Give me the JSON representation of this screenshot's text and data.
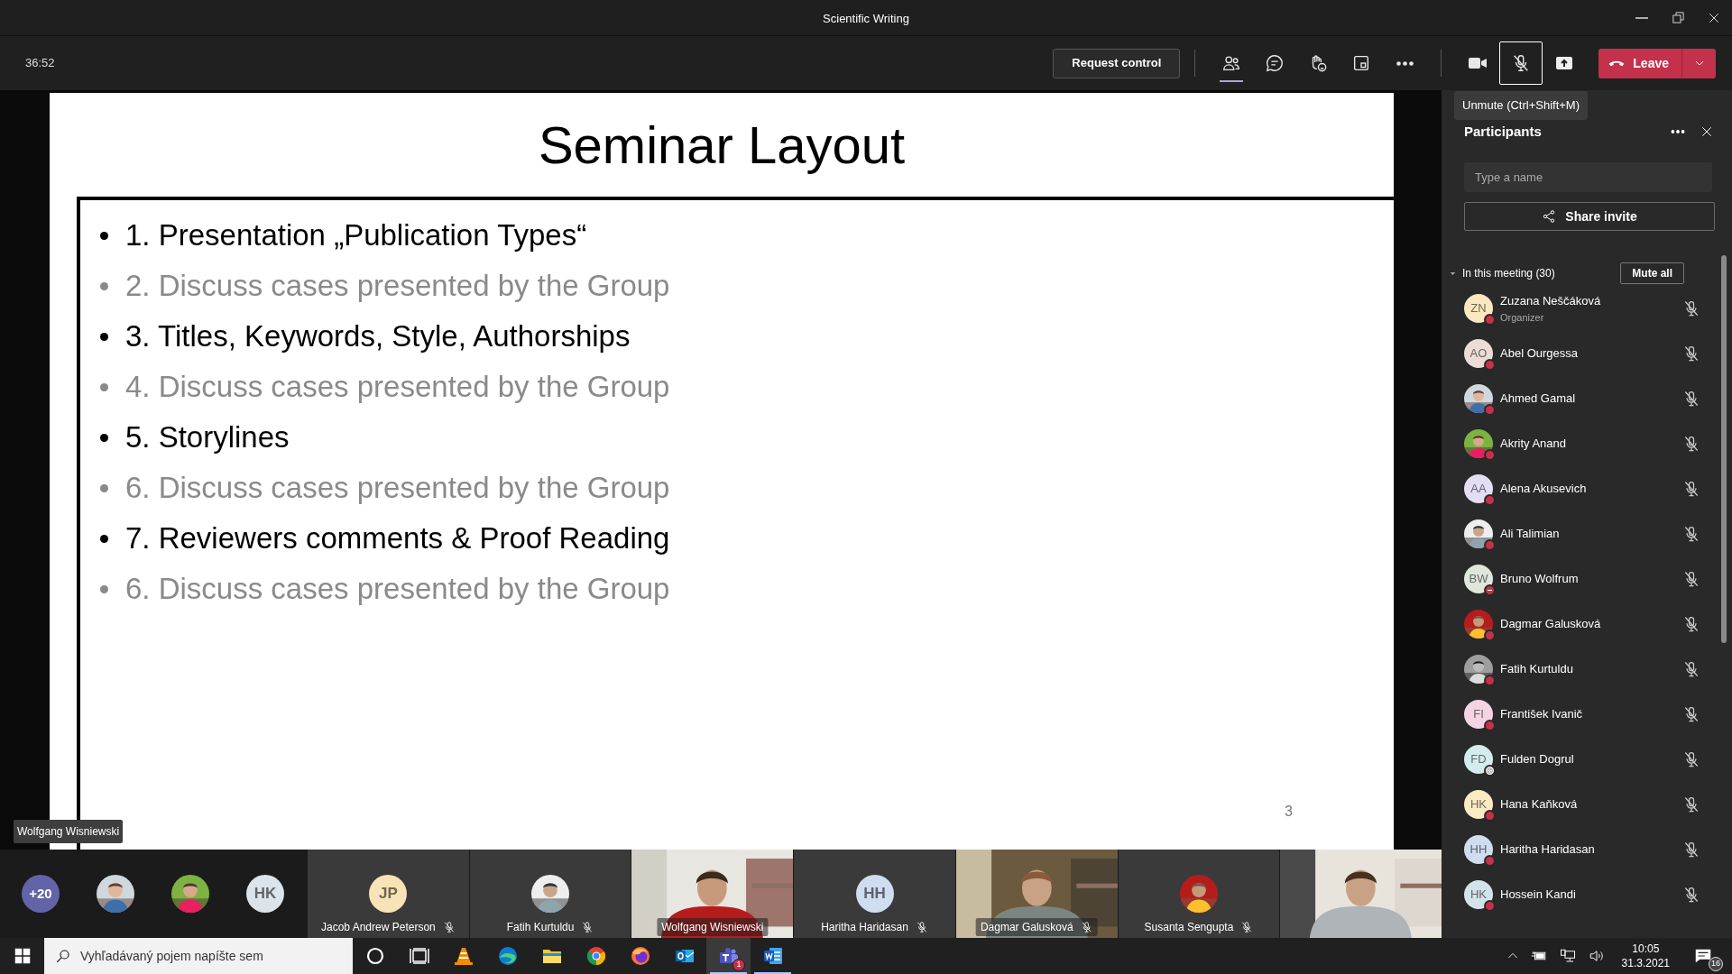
{
  "window": {
    "title": "Scientific Writing"
  },
  "toolbar": {
    "timer": "36:52",
    "request_control": "Request control",
    "buttons": [
      {
        "kind": "people",
        "selected": true
      },
      {
        "kind": "chat",
        "selected": false
      },
      {
        "kind": "reactions",
        "selected": false
      },
      {
        "kind": "rooms",
        "selected": false
      },
      {
        "kind": "more",
        "selected": false
      }
    ],
    "camera": {
      "on": true
    },
    "mic": {
      "on": false,
      "tooltip": "Unmute (Ctrl+Shift+M)"
    },
    "leave": "Leave"
  },
  "slide": {
    "title": "Seminar Layout",
    "bullets": [
      {
        "text": "1. Presentation „Publication Types“",
        "dimmed": false
      },
      {
        "text": "2. Discuss cases presented by the Group",
        "dimmed": true
      },
      {
        "text": "3. Titles, Keywords, Style, Authorships",
        "dimmed": false
      },
      {
        "text": "4. Discuss cases presented by the Group",
        "dimmed": true
      },
      {
        "text": "5. Storylines",
        "dimmed": false
      },
      {
        "text": "6. Discuss cases presented by the Group",
        "dimmed": true
      },
      {
        "text": "7. Reviewers comments & Proof Reading",
        "dimmed": false
      },
      {
        "text": "6. Discuss cases presented by the Group",
        "dimmed": true
      }
    ],
    "page": "3"
  },
  "presenter": "Wolfgang Wisniewski",
  "participants": {
    "title": "Participants",
    "search": {
      "placeholder": "Type a name"
    },
    "share_invite": "Share invite",
    "section": {
      "label": "In this meeting (30)",
      "expanded": true
    },
    "mute_all": "Mute all",
    "people": [
      {
        "name": "Zuzana Neščáková",
        "role": "Organizer",
        "avatar": {
          "kind": "initials",
          "initials": "ZN",
          "color": "#f9e8c0"
        },
        "status": {
          "kind": "busy",
          "color": "#c4314b"
        },
        "muted": true
      },
      {
        "name": "Abel Ourgessa",
        "avatar": {
          "kind": "initials",
          "initials": "AO",
          "color": "#ecdcd6"
        },
        "status": {
          "kind": "busy",
          "color": "#c4314b"
        },
        "muted": true
      },
      {
        "name": "Ahmed Gamal",
        "avatar": {
          "kind": "picture"
        },
        "status": {
          "kind": "busy",
          "color": "#c4314b"
        },
        "muted": true
      },
      {
        "name": "Akrity Anand",
        "avatar": {
          "kind": "picture"
        },
        "status": {
          "kind": "busy",
          "color": "#c4314b"
        },
        "muted": true
      },
      {
        "name": "Alena Akusevich",
        "avatar": {
          "kind": "initials",
          "initials": "AA",
          "color": "#e4def2"
        },
        "status": {
          "kind": "busy",
          "color": "#c4314b"
        },
        "muted": true
      },
      {
        "name": "Ali Talimian",
        "avatar": {
          "kind": "picture"
        },
        "status": {
          "kind": "busy",
          "color": "#c4314b"
        },
        "muted": true
      },
      {
        "name": "Bruno Wolfrum",
        "avatar": {
          "kind": "initials",
          "initials": "BW",
          "color": "#dfe6dc"
        },
        "status": {
          "kind": "dnd",
          "color": "#c4314b"
        },
        "muted": true
      },
      {
        "name": "Dagmar Galusková",
        "avatar": {
          "kind": "picture"
        },
        "status": {
          "kind": "busy",
          "color": "#c4314b"
        },
        "muted": true
      },
      {
        "name": "Fatih Kurtuldu",
        "avatar": {
          "kind": "picture"
        },
        "status": {
          "kind": "busy",
          "color": "#c4314b"
        },
        "muted": true
      },
      {
        "name": "František Ivanič",
        "avatar": {
          "kind": "initials",
          "initials": "FI",
          "color": "#f4d4e3"
        },
        "status": {
          "kind": "busy",
          "color": "#c4314b"
        },
        "muted": true
      },
      {
        "name": "Fulden Dogrul",
        "avatar": {
          "kind": "initials",
          "initials": "FD",
          "color": "#d5ecef"
        },
        "status": {
          "kind": "offline",
          "color": "#ffffff"
        },
        "muted": true
      },
      {
        "name": "Hana Kaňková",
        "avatar": {
          "kind": "initials",
          "initials": "HK",
          "color": "#fbeac3"
        },
        "status": {
          "kind": "busy",
          "color": "#c4314b"
        },
        "muted": true
      },
      {
        "name": "Haritha Haridasan",
        "avatar": {
          "kind": "initials",
          "initials": "HH",
          "color": "#d0dcef"
        },
        "status": {
          "kind": "busy",
          "color": "#c4314b"
        },
        "muted": true
      },
      {
        "name": "Hossein Kandi",
        "avatar": {
          "kind": "initials",
          "initials": "HK",
          "color": "#d3e3ea"
        },
        "status": {
          "kind": "busy",
          "color": "#c4314b"
        },
        "muted": true
      }
    ]
  },
  "gallery": {
    "overflow": "+20",
    "avatars": [
      {
        "kind": "picture"
      },
      {
        "kind": "picture"
      },
      {
        "kind": "initials",
        "initials": "HK",
        "color": "#dbe4ea"
      }
    ],
    "tiles": [
      {
        "kind": "initials",
        "initials": "JP",
        "color": "#f7e3b5",
        "name": "Jacob Andrew Peterson",
        "muted": true
      },
      {
        "kind": "picture",
        "name": "Fatih Kurtuldu",
        "muted": true
      },
      {
        "kind": "video",
        "name": "Wolfgang Wisniewski",
        "muted": false
      },
      {
        "kind": "initials",
        "initials": "HH",
        "color": "#d0dcef",
        "name": "Haritha Haridasan",
        "muted": true
      },
      {
        "kind": "video",
        "name": "Dagmar Galusková",
        "muted": true
      },
      {
        "kind": "picture",
        "name": "Susanta Sengupta",
        "muted": true
      },
      {
        "kind": "video",
        "muted": false
      }
    ]
  },
  "taskbar": {
    "search": {
      "placeholder": "Vyhľadávaný pojem napíšte sem"
    },
    "apps": [
      {
        "kind": "cortana",
        "running": false,
        "active": false
      },
      {
        "kind": "taskview",
        "running": false,
        "active": false
      },
      {
        "kind": "vlc",
        "running": false,
        "active": false
      },
      {
        "kind": "edge",
        "running": false,
        "active": false
      },
      {
        "kind": "files",
        "running": false,
        "active": false
      },
      {
        "kind": "chrome",
        "running": false,
        "active": false
      },
      {
        "kind": "firefox",
        "running": false,
        "active": false
      },
      {
        "kind": "outlook",
        "running": false,
        "active": false
      },
      {
        "kind": "teams",
        "running": true,
        "active": true,
        "badge": "1"
      },
      {
        "kind": "word",
        "running": true,
        "active": false
      }
    ],
    "time": "10:05",
    "date": "31.3.2021",
    "notifications": "16"
  }
}
